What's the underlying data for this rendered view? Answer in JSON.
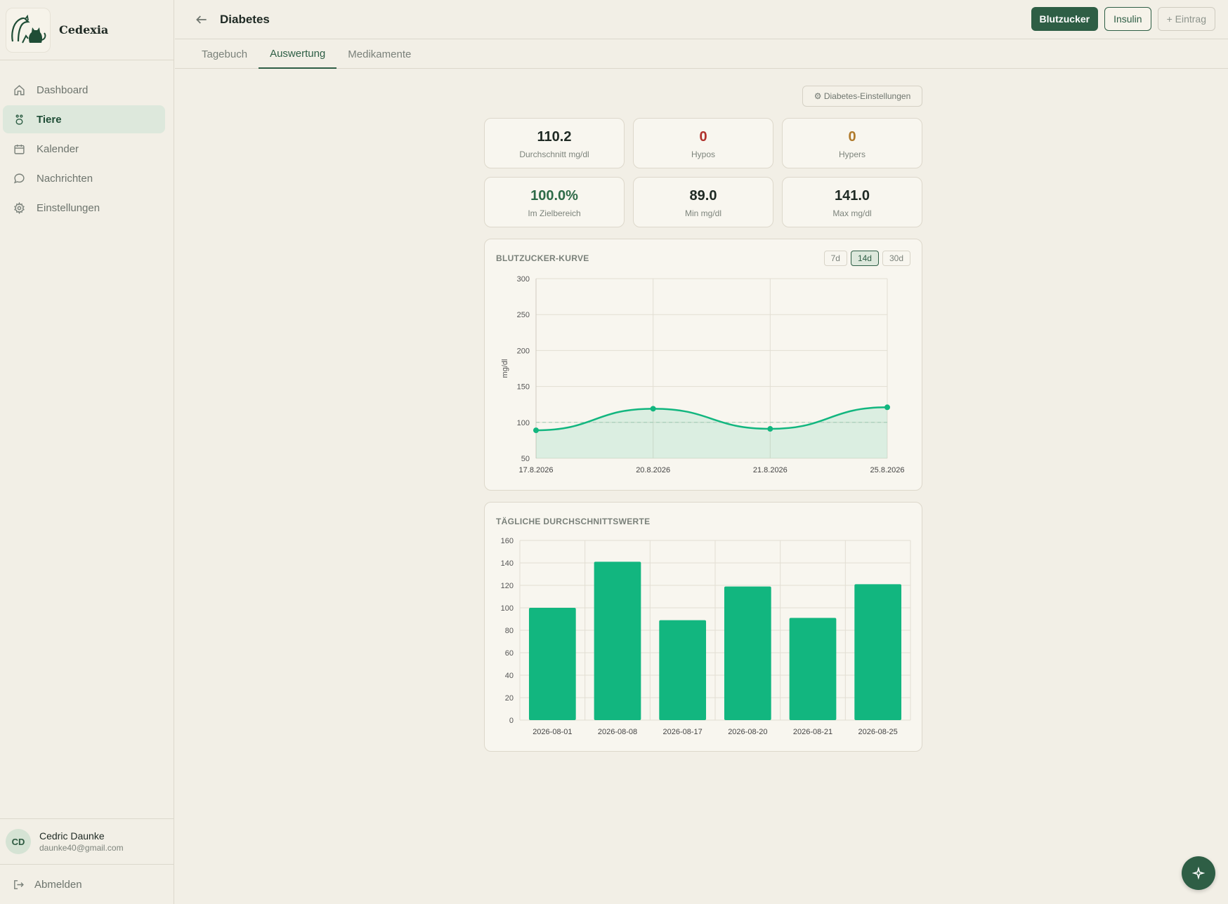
{
  "brand": {
    "name": "Cedexia"
  },
  "sidebar": {
    "items": [
      {
        "label": "Dashboard",
        "icon": "home-icon"
      },
      {
        "label": "Tiere",
        "icon": "paw-icon"
      },
      {
        "label": "Kalender",
        "icon": "calendar-icon"
      },
      {
        "label": "Nachrichten",
        "icon": "chat-icon"
      },
      {
        "label": "Einstellungen",
        "icon": "gear-icon"
      }
    ],
    "active": "Tiere"
  },
  "user": {
    "initials": "CD",
    "name": "Cedric Daunke",
    "email": "daunke40@gmail.com"
  },
  "logout_label": "Abmelden",
  "header": {
    "title": "Diabetes",
    "buttons": {
      "blutzucker": "Blutzucker",
      "insulin": "Insulin",
      "eintrag": "+ Eintrag"
    }
  },
  "tabs": [
    "Tagebuch",
    "Auswertung",
    "Medikamente"
  ],
  "active_tab": "Auswertung",
  "settings_button": "⚙ Diabetes-Einstellungen",
  "stats": [
    {
      "value": "110.2",
      "label": "Durchschnitt mg/dl",
      "color": "#1f2a24"
    },
    {
      "value": "0",
      "label": "Hypos",
      "color": "#b0312b"
    },
    {
      "value": "0",
      "label": "Hypers",
      "color": "#b07a2b"
    },
    {
      "value": "100.0%",
      "label": "Im Zielbereich",
      "color": "#2e6b48"
    },
    {
      "value": "89.0",
      "label": "Min mg/dl",
      "color": "#1f2a24"
    },
    {
      "value": "141.0",
      "label": "Max mg/dl",
      "color": "#1f2a24"
    }
  ],
  "line_card": {
    "title": "BLUTZUCKER-KURVE",
    "ranges": [
      "7d",
      "14d",
      "30d"
    ],
    "active_range": "14d"
  },
  "bar_card": {
    "title": "TÄGLICHE DURCHSCHNITTSWERTE"
  },
  "colors": {
    "accent": "#2e5e45",
    "series": "#12b67f"
  },
  "chart_data": [
    {
      "type": "line",
      "title": "BLUTZUCKER-KURVE",
      "x": [
        "17.8.2026",
        "20.8.2026",
        "21.8.2026",
        "25.8.2026"
      ],
      "values": [
        89,
        119,
        91,
        121
      ],
      "ylabel": "mg/dl",
      "ylim": [
        50,
        300
      ],
      "yticks": [
        50,
        100,
        150,
        200,
        250,
        300
      ],
      "reference_line": 100,
      "area_fill": true,
      "grid": true
    },
    {
      "type": "bar",
      "title": "TÄGLICHE DURCHSCHNITTSWERTE",
      "categories": [
        "2026-08-01",
        "2026-08-08",
        "2026-08-17",
        "2026-08-20",
        "2026-08-21",
        "2026-08-25"
      ],
      "values": [
        100,
        141,
        89,
        119,
        91,
        121
      ],
      "ylim": [
        0,
        160
      ],
      "yticks": [
        0,
        20,
        40,
        60,
        80,
        100,
        120,
        140,
        160
      ],
      "grid": true
    }
  ]
}
